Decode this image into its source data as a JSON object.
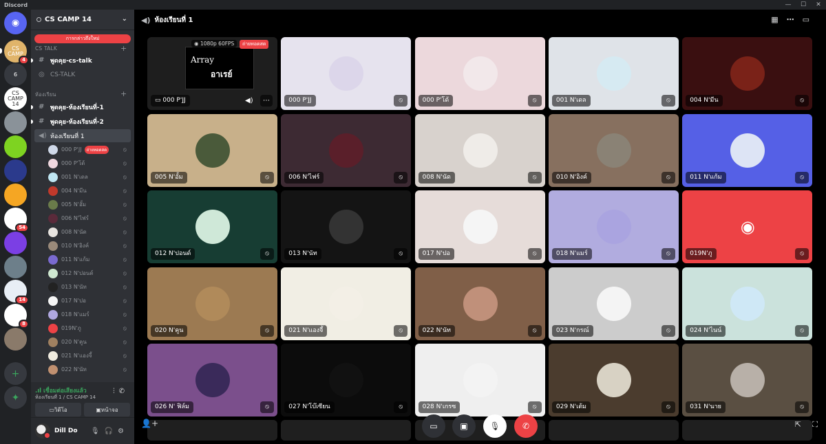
{
  "titlebar": {
    "app": "Discord",
    "controls": [
      "—",
      "☐",
      "✕"
    ]
  },
  "guilds": [
    {
      "label": "",
      "color": "#5865f2",
      "badge": "",
      "icon": "discord-home-icon"
    },
    {
      "label": "CS CAMP",
      "color": "#e0b46a",
      "badge": "4"
    },
    {
      "label": "6",
      "color": "#36393f",
      "badge": ""
    },
    {
      "label": "CS CAMP 14",
      "color": "#ffffff",
      "badge": ""
    },
    {
      "label": "",
      "color": "#8a9299",
      "badge": ""
    },
    {
      "label": "",
      "color": "#7ed321",
      "badge": ""
    },
    {
      "label": "",
      "color": "#2b3a8c",
      "badge": ""
    },
    {
      "label": "",
      "color": "#f5a623",
      "badge": ""
    },
    {
      "label": "",
      "color": "#ffffff",
      "badge": "54"
    },
    {
      "label": "",
      "color": "#7b3fe4",
      "badge": ""
    },
    {
      "label": "",
      "color": "#6d7f8a",
      "badge": ""
    },
    {
      "label": "",
      "color": "#e8eef5",
      "badge": "14"
    },
    {
      "label": "",
      "color": "#ffffff",
      "badge": "8"
    },
    {
      "label": "",
      "color": "#8a7a6a",
      "badge": ""
    }
  ],
  "sidebar": {
    "server_name": "CS CAMP 14",
    "new_messages": "การกล่าวถึงใหม่",
    "categories": [
      {
        "name": "CS TALK"
      },
      {
        "name": "ห้องเรียน"
      }
    ],
    "channels": [
      {
        "name": "พูดคุย-cs-talk",
        "type": "text",
        "unread": true
      },
      {
        "name": "CS-TALK",
        "type": "stage",
        "unread": false
      },
      {
        "name": "พูดคุย-ห้องเรียนที่-1",
        "type": "text",
        "unread": true
      },
      {
        "name": "พูดคุย-ห้องเรียนที่-2",
        "type": "text",
        "unread": true
      },
      {
        "name": "ห้องเรียนที่ 1",
        "type": "voice",
        "selected": true
      }
    ],
    "voice_users": [
      {
        "name": "000 P'JJ",
        "color": "#cfd8e8",
        "live": "ถ่ายทอดสด"
      },
      {
        "name": "000 P'โด้",
        "color": "#f0d8e0"
      },
      {
        "name": "001 N'เดล",
        "color": "#bfe6f2"
      },
      {
        "name": "004 N'มีน",
        "color": "#c0392b"
      },
      {
        "name": "005 N'อั้ม",
        "color": "#6a7b4a"
      },
      {
        "name": "006 N'ไฟร์",
        "color": "#5a2a3a"
      },
      {
        "name": "008 N'นัด",
        "color": "#e8e4e0"
      },
      {
        "name": "010 N'อิงค์",
        "color": "#9a8a7a"
      },
      {
        "name": "011 N'แก้ม",
        "color": "#7a6ad0"
      },
      {
        "name": "012 N'ปอนด์",
        "color": "#cfe8d0"
      },
      {
        "name": "013 N'นัท",
        "color": "#222222"
      },
      {
        "name": "017 N'ปอ",
        "color": "#f5f5f5"
      },
      {
        "name": "018 N'แมร์",
        "color": "#b0a8e0"
      },
      {
        "name": "019N'ภู",
        "color": "#ed4245"
      },
      {
        "name": "020 N'คูน",
        "color": "#a08060"
      },
      {
        "name": "021 N'แองจี้",
        "color": "#f0ece0"
      },
      {
        "name": "022 N'นัท",
        "color": "#c09070"
      }
    ],
    "voice_status": "เชื่อมต่อเสียงแล้ว",
    "voice_sub": "ห้องเรียนที่ 1 / CS CAMP 14",
    "video_label": "วิดีโอ",
    "screen_label": "หน้าจอ",
    "username": "Dill Do"
  },
  "main": {
    "title": "ห้องเรียนที่ 1"
  },
  "tiles": [
    {
      "name": "000 P'JJ",
      "bg": "#1e1e1e",
      "av": "",
      "stream": true,
      "quality": "1080p 60FPS",
      "live": "ถ่ายทอดสด",
      "slide1": "Array",
      "slide2": "อาเรย์"
    },
    {
      "name": "000 P'JJ",
      "bg": "#e6e3ee",
      "av": "#dcd6ea"
    },
    {
      "name": "000 P'โด้",
      "bg": "#ecd8dc",
      "av": "#f2e8ea"
    },
    {
      "name": "001 N'เดล",
      "bg": "#dfe3e8",
      "av": "#d6eaf2"
    },
    {
      "name": "004 N'มีน",
      "bg": "#3a0f10",
      "av": "#7a2218"
    },
    {
      "name": "005 N'อั้ม",
      "bg": "#c8b08a",
      "av": "#4a5a3a"
    },
    {
      "name": "006 N'ไฟร์",
      "bg": "#3d2a33",
      "av": "#5a1f2a"
    },
    {
      "name": "008 N'นัด",
      "bg": "#d8d2cd",
      "av": "#efece8"
    },
    {
      "name": "010 N'อิงค์",
      "bg": "#87705f",
      "av": "#8a8275"
    },
    {
      "name": "011 N'แก้ม",
      "bg": "#5560e6",
      "av": "#dde4f5"
    },
    {
      "name": "012 N'ปอนด์",
      "bg": "#173d33",
      "av": "#cfe8d8"
    },
    {
      "name": "013 N'นัท",
      "bg": "#141414",
      "av": "#333333"
    },
    {
      "name": "017 N'ปอ",
      "bg": "#e6dcd9",
      "av": "#f5f5f5"
    },
    {
      "name": "018 N'แมร์",
      "bg": "#b1acdf",
      "av": "#aaa4e0"
    },
    {
      "name": "019N'ภู",
      "bg": "#ed4245",
      "av": "#ed4245",
      "discord": true
    },
    {
      "name": "020 N'คูน",
      "bg": "#9c7a52",
      "av": "#b08a5a"
    },
    {
      "name": "021 N'แองจี้",
      "bg": "#f1eee4",
      "av": "#f3efe6"
    },
    {
      "name": "022 N'นัท",
      "bg": "#805f48",
      "av": "#c0907a"
    },
    {
      "name": "023 N'กรณ์",
      "bg": "#cccccc",
      "av": "#f4f4f4"
    },
    {
      "name": "024 N'ไนน์",
      "bg": "#cbe2dc",
      "av": "#cfe8f6"
    },
    {
      "name": "026 N' ฟิล์ม",
      "bg": "#7b4f8c",
      "av": "#3a2a5a"
    },
    {
      "name": "027 N'โบ๊เซียน",
      "bg": "#0c0c0c",
      "av": "#111111"
    },
    {
      "name": "028 N'เกรซ",
      "bg": "#efefef",
      "av": "#f3f3f3"
    },
    {
      "name": "029 N'เต้ม",
      "bg": "#4b3c2e",
      "av": "#d8d2c4"
    },
    {
      "name": "031 N'นาย",
      "bg": "#5a4f42",
      "av": "#b8b0a8"
    }
  ]
}
